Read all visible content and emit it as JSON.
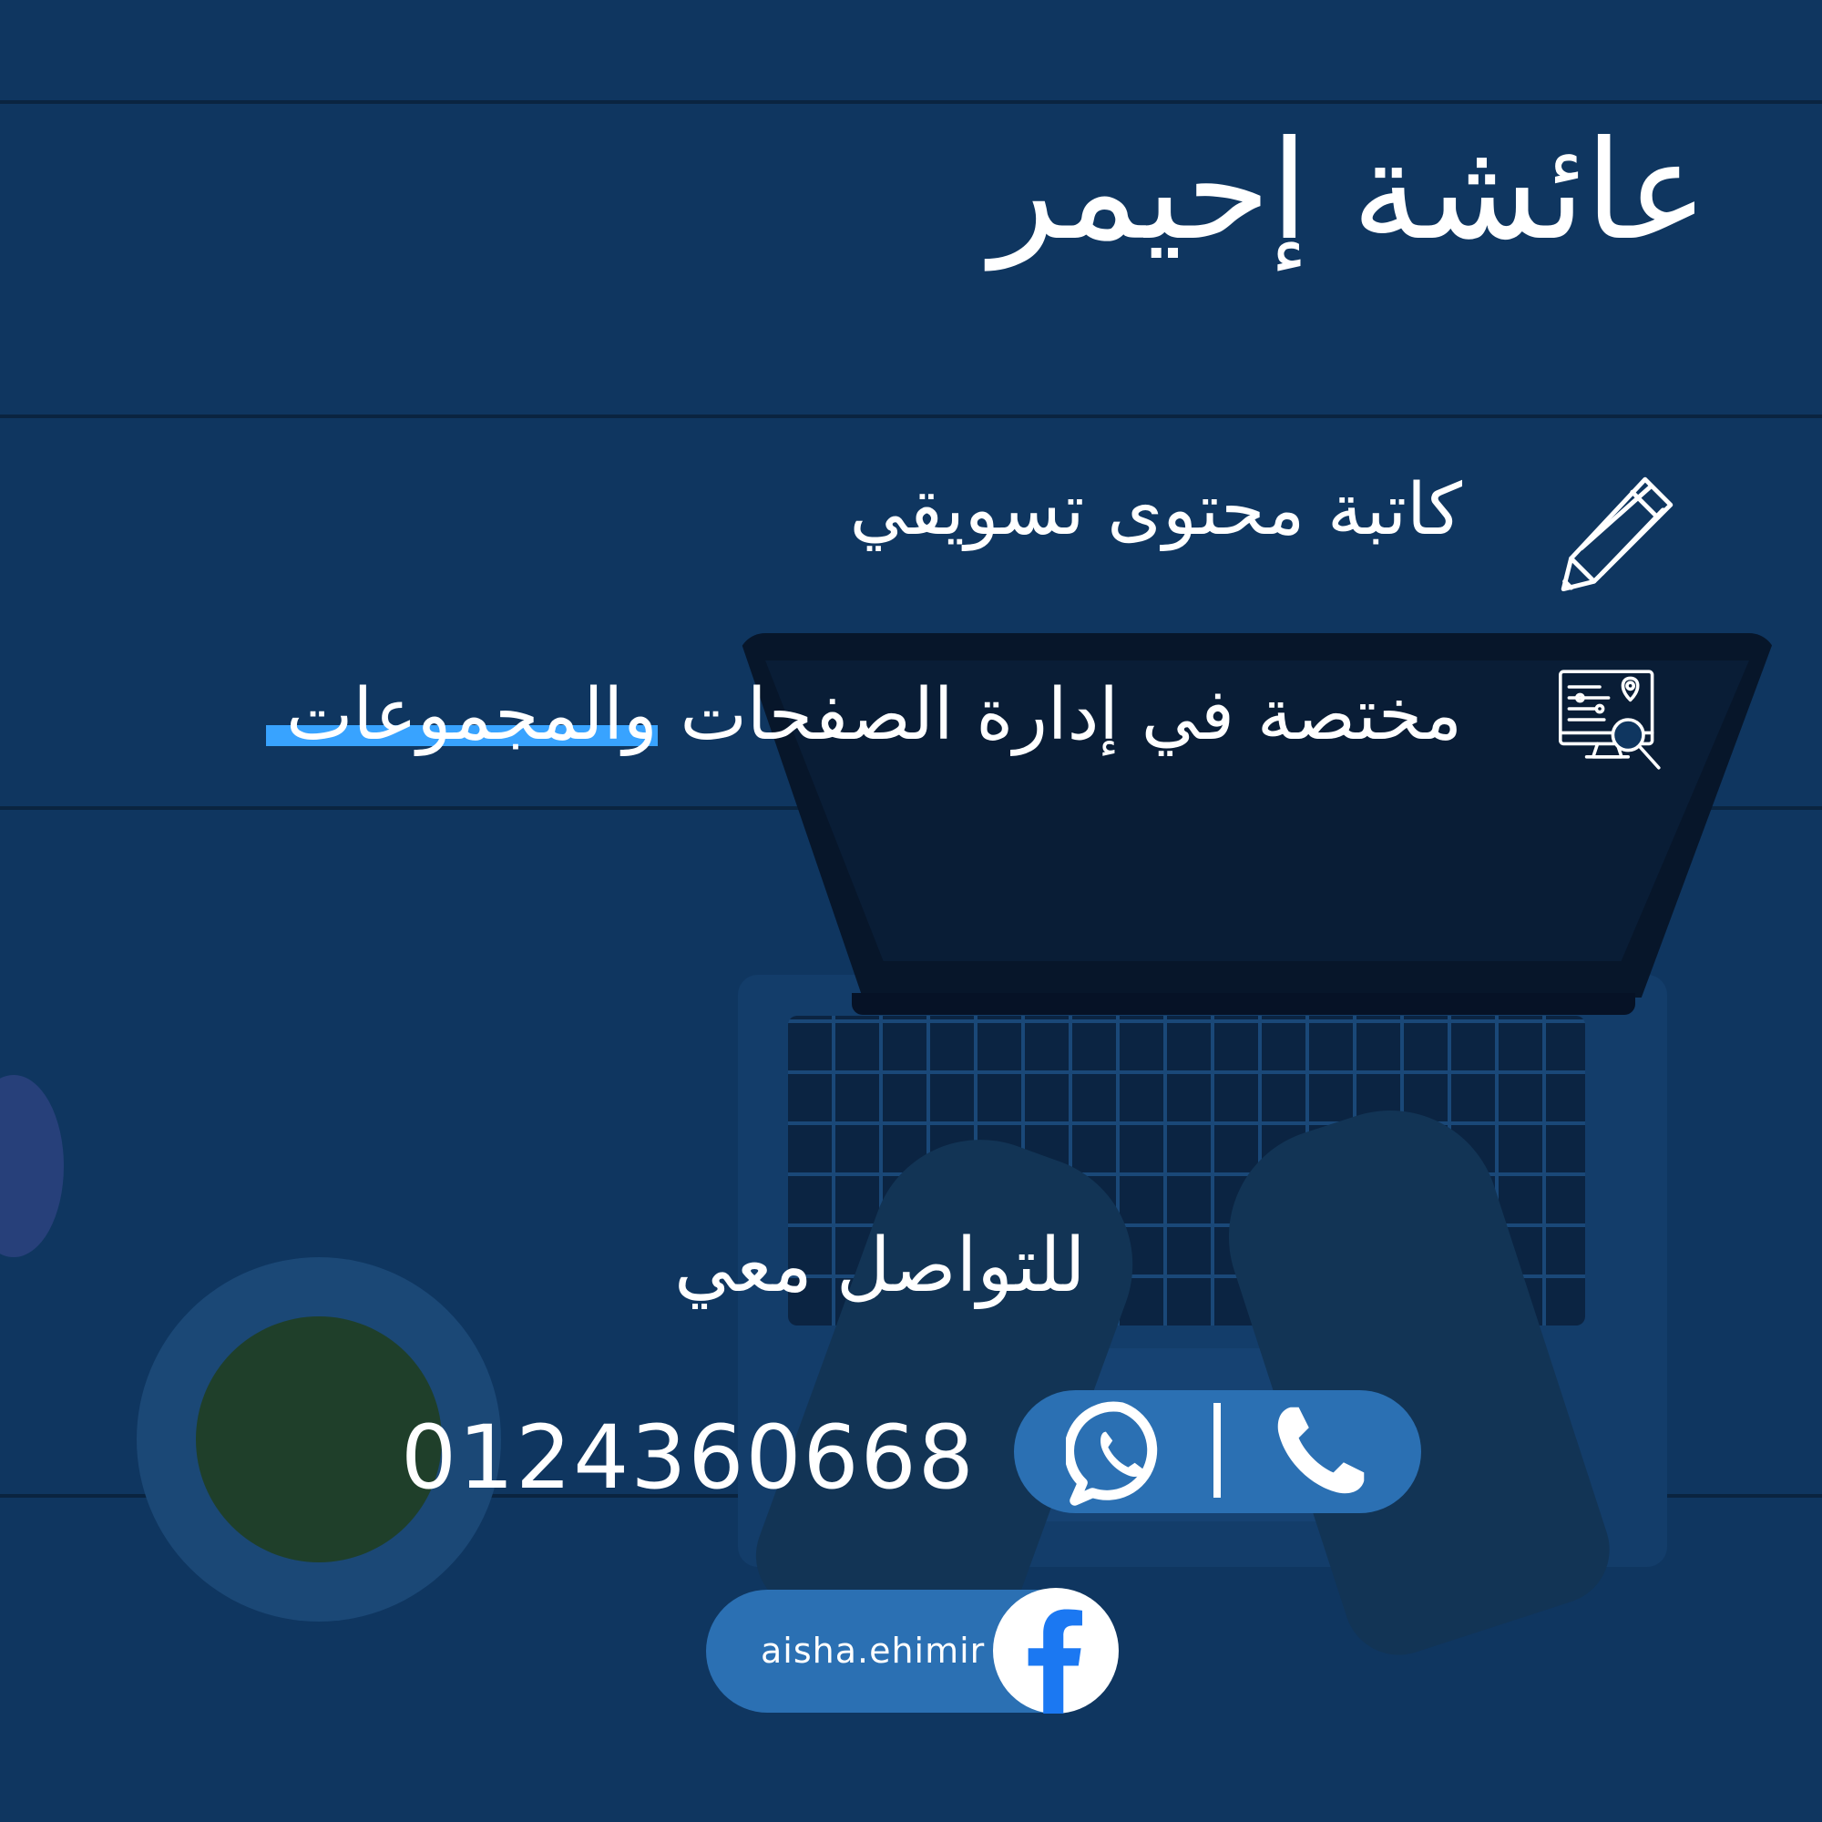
{
  "profile": {
    "name": "عائشة إحيمر"
  },
  "services": [
    {
      "icon": "pencil-icon",
      "text": "كاتبة محتوى تسويقي"
    },
    {
      "icon": "seo-monitor-icon",
      "text_main": "مختصة في إدارة الصفحات ",
      "text_highlight": "والمجموعات"
    }
  ],
  "contact": {
    "heading": "للتواصل معي",
    "phone": "0124360668",
    "phone_icons": [
      "whatsapp-icon",
      "phone-icon"
    ],
    "facebook_handle": "aisha.ehimir",
    "facebook_icon": "facebook-icon"
  },
  "colors": {
    "background": "#0f3660",
    "accent": "#38a3ff",
    "pill": "#2b70b3",
    "text": "#ffffff"
  }
}
